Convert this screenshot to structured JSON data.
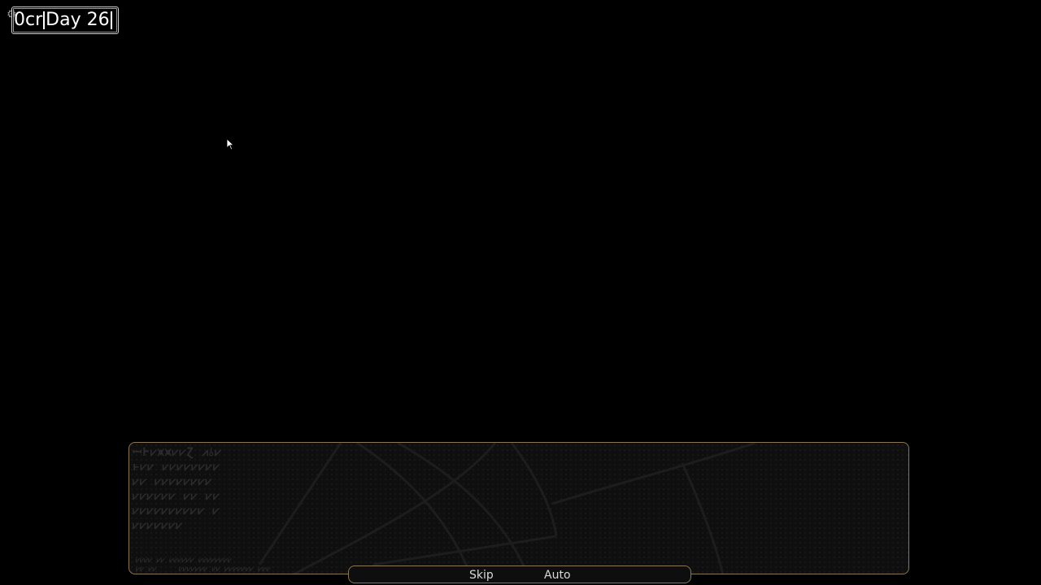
{
  "hud": {
    "credits": "0cr",
    "day": "Day 26"
  },
  "icons": {
    "settings": "gear-icon",
    "cursor": "mouse-pointer-icon"
  },
  "textbox": {
    "background_script_lines": [],
    "footer_script_lines": []
  },
  "controls": {
    "skip_label": "Skip",
    "auto_label": "Auto"
  },
  "colors": {
    "background": "#000000",
    "hud_text": "#ffffff",
    "frame_border": "#8a7555",
    "panel_fill": "#0f0f0f",
    "button_text": "#d8d8d8"
  }
}
